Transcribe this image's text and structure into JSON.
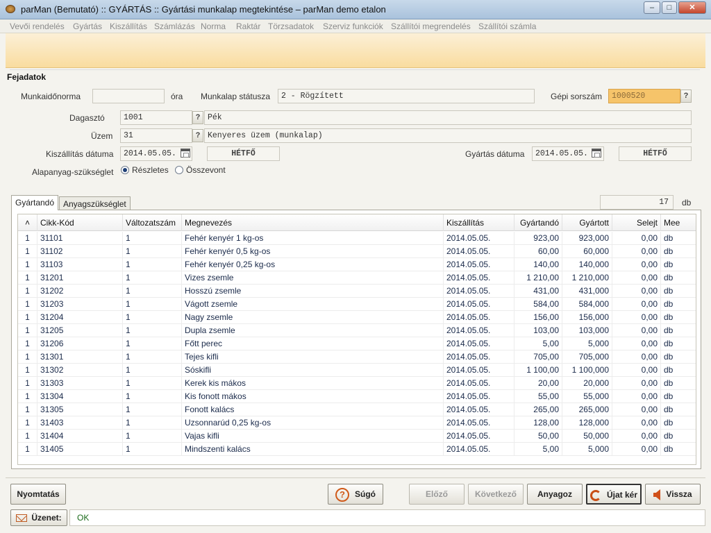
{
  "window": {
    "title": "parMan (Bemutató) :: GYÁRTÁS :: Gyártási munkalap megtekintése   –   parMan demo etalon"
  },
  "menu": [
    "Vevői rendelés",
    "Gyártás",
    "Kiszállítás",
    "Számlázás",
    "Norma",
    "Raktár",
    "Törzsadatok",
    "Szerviz funkciók",
    "Szállítói megrendelés",
    "Szállítói számla"
  ],
  "header": {
    "section_title": "Fejadatok",
    "munkaidonorma_label": "Munkaidőnorma",
    "munkaidonorma_value": "",
    "ora_label": "óra",
    "statusz_label": "Munkalap státusza",
    "statusz_value": "2 - Rögzített",
    "gepi_label": "Gépi sorszám",
    "gepi_value": "1000520",
    "dagaszto_label": "Dagasztó",
    "dagaszto_code": "1001",
    "dagaszto_name": "Pék",
    "uzem_label": "Üzem",
    "uzem_code": "31",
    "uzem_name": "Kenyeres üzem (munkalap)",
    "kiszall_label": "Kiszállítás dátuma",
    "kiszall_date": "2014.05.05.",
    "kiszall_day": "HÉTFŐ",
    "gyartas_label": "Gyártás dátuma",
    "gyartas_date": "2014.05.05.",
    "gyartas_day": "HÉTFŐ",
    "alapanyag_label": "Alapanyag-szükséglet",
    "radio_reszletes": "Részletes",
    "radio_osszevont": "Összevont",
    "help_q": "?"
  },
  "tabs": {
    "gyartando": "Gyártandó",
    "anyag": "Anyagszükséglet"
  },
  "count": {
    "value": "17",
    "unit": "db"
  },
  "columns": [
    "",
    "Cikk-Kód",
    "Változatszám",
    "Megnevezés",
    "Kiszállítás",
    "Gyártandó",
    "Gyártott",
    "Selejt",
    "Mee"
  ],
  "rows": [
    [
      "1",
      "31101",
      "1",
      "Fehér kenyér 1 kg-os",
      "2014.05.05.",
      "923,00",
      "923,000",
      "0,00",
      "db"
    ],
    [
      "1",
      "31102",
      "1",
      "Fehér kenyér 0,5 kg-os",
      "2014.05.05.",
      "60,00",
      "60,000",
      "0,00",
      "db"
    ],
    [
      "1",
      "31103",
      "1",
      "Fehér kenyér 0,25 kg-os",
      "2014.05.05.",
      "140,00",
      "140,000",
      "0,00",
      "db"
    ],
    [
      "1",
      "31201",
      "1",
      "Vizes zsemle",
      "2014.05.05.",
      "1 210,00",
      "1 210,000",
      "0,00",
      "db"
    ],
    [
      "1",
      "31202",
      "1",
      "Hosszú zsemle",
      "2014.05.05.",
      "431,00",
      "431,000",
      "0,00",
      "db"
    ],
    [
      "1",
      "31203",
      "1",
      "Vágott zsemle",
      "2014.05.05.",
      "584,00",
      "584,000",
      "0,00",
      "db"
    ],
    [
      "1",
      "31204",
      "1",
      "Nagy zsemle",
      "2014.05.05.",
      "156,00",
      "156,000",
      "0,00",
      "db"
    ],
    [
      "1",
      "31205",
      "1",
      "Dupla zsemle",
      "2014.05.05.",
      "103,00",
      "103,000",
      "0,00",
      "db"
    ],
    [
      "1",
      "31206",
      "1",
      "Főtt perec",
      "2014.05.05.",
      "5,00",
      "5,000",
      "0,00",
      "db"
    ],
    [
      "1",
      "31301",
      "1",
      "Tejes kifli",
      "2014.05.05.",
      "705,00",
      "705,000",
      "0,00",
      "db"
    ],
    [
      "1",
      "31302",
      "1",
      "Sóskifli",
      "2014.05.05.",
      "1 100,00",
      "1 100,000",
      "0,00",
      "db"
    ],
    [
      "1",
      "31303",
      "1",
      "Kerek kis mákos",
      "2014.05.05.",
      "20,00",
      "20,000",
      "0,00",
      "db"
    ],
    [
      "1",
      "31304",
      "1",
      "Kis fonott mákos",
      "2014.05.05.",
      "55,00",
      "55,000",
      "0,00",
      "db"
    ],
    [
      "1",
      "31305",
      "1",
      "Fonott kalács",
      "2014.05.05.",
      "265,00",
      "265,000",
      "0,00",
      "db"
    ],
    [
      "1",
      "31403",
      "1",
      "Uzsonnarúd 0,25 kg-os",
      "2014.05.05.",
      "128,00",
      "128,000",
      "0,00",
      "db"
    ],
    [
      "1",
      "31404",
      "1",
      "Vajas kifli",
      "2014.05.05.",
      "50,00",
      "50,000",
      "0,00",
      "db"
    ],
    [
      "1",
      "31405",
      "1",
      "Mindszenti kalács",
      "2014.05.05.",
      "5,00",
      "5,000",
      "0,00",
      "db"
    ]
  ],
  "buttons": {
    "print": "Nyomtatás",
    "help": "Súgó",
    "prev": "Előző",
    "next": "Következő",
    "material": "Anyagoz",
    "refresh": "Újat kér",
    "back": "Vissza"
  },
  "message": {
    "label": "Üzenet:",
    "value": "OK"
  }
}
